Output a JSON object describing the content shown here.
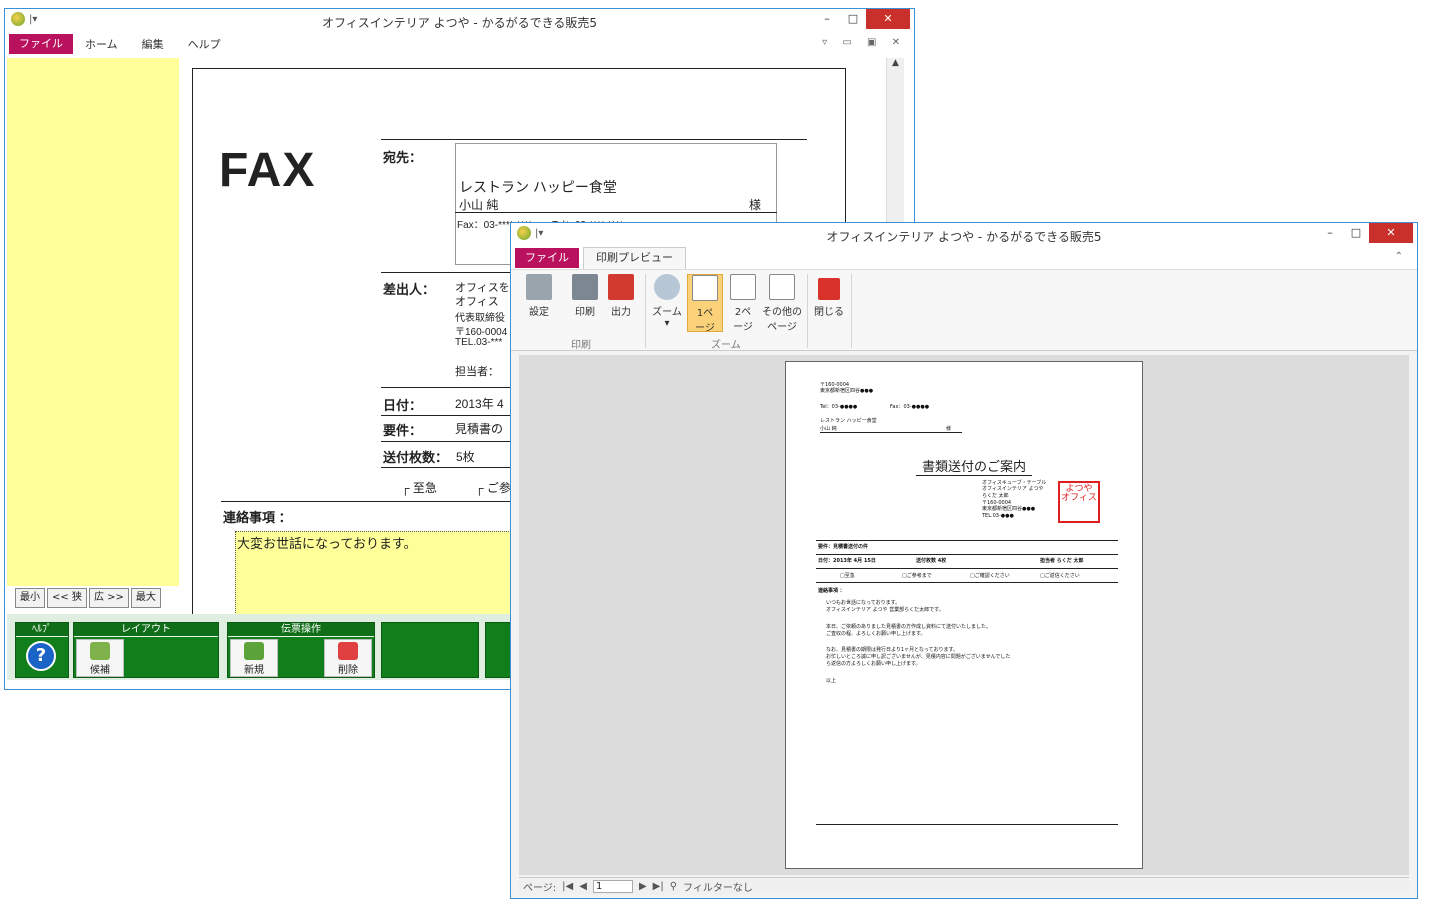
{
  "back": {
    "title": "オフィスインテリア よつや - かるがるできる販売5",
    "menu": [
      "ファイル",
      "ホーム",
      "編集",
      "ヘルプ"
    ],
    "zoom_buttons": [
      "最小",
      "<< 狭",
      "広 >>",
      "最大"
    ],
    "fax": {
      "heading": "FAX",
      "to_label": "宛先：",
      "to_company": "レストラン ハッピー食堂",
      "to_person": "小山 純",
      "to_suffix": "様",
      "to_contact": "Fax：03-**** ****　　Tel：03-**** ****",
      "from_label": "差出人：",
      "from_lines": [
        "オフィスを",
        "オフィス",
        "代表取締役",
        "〒160-0004",
        "TEL.03-***"
      ],
      "staff_label": "担当者：",
      "date_label": "日付：",
      "date_value": "2013年 4",
      "subject_label": "要件：",
      "subject_value": "見積書の",
      "pages_label": "送付枚数：",
      "pages_value": "5枚",
      "check1": "至急",
      "check2": "ご参",
      "notes_label": "連絡事項 ：",
      "notes_text": "大変お世話になっております。"
    },
    "bottom_groups": [
      {
        "label": "ﾍﾙﾌﾟ"
      },
      {
        "label": "レイアウト",
        "button": "候補"
      },
      {
        "label": "伝票操作",
        "buttons": [
          "新規",
          "削除"
        ]
      }
    ]
  },
  "front": {
    "title": "オフィスインテリア よつや - かるがるできる販売5",
    "tabs": [
      "ファイル",
      "印刷プレビュー"
    ],
    "buttons": {
      "setup": "設定",
      "print": "印刷",
      "output": "出力",
      "zoom": "ズーム",
      "one_page": "1ペ\nージ",
      "two_page": "2ペ\nージ",
      "other_pages": "その他の\nページ",
      "close": "閉じる"
    },
    "groups": {
      "print": "印刷",
      "zoom": "ズーム"
    },
    "page": {
      "header_lines": [
        "〒160-0004",
        "東京都新宿区四谷●●●",
        "Tel：03-●●●●",
        "Fax：03-●●●●"
      ],
      "to_company": "レストラン ハッピー食堂",
      "to_person": "小山 純",
      "to_suffix": "様",
      "doc_title": "書類送付のご案内",
      "stamp_text": "よつや\nオフィス",
      "sender_lines": [
        "オフィスキューブ・テーブル",
        "オフィスインテリア よつや",
        "らくだ 太郎",
        "〒160-0004",
        "東京都新宿区四谷●●●",
        "TEL.03-●●●"
      ],
      "subject": "要件：見積書送付の件",
      "date": "日付：2013年 4月 15日",
      "pages": "送付枚数 4枚",
      "staff": "担当者 らくだ 太郎",
      "checks": [
        "□至急",
        "□ご参考まで",
        "□ご確認ください",
        "□ご返信ください"
      ],
      "notes_label": "連絡事項 ：",
      "body": [
        "いつもお世話になっております。",
        "オフィスインテリア よつや 営業部らくだ太郎です。",
        "",
        "本日、ご依頼のありました見積書の方作成し資料にて送付いたしました。",
        "ご査収の程、よろしくお願い申し上げます。",
        "",
        "なお、見積書の期限は発行日より1ヶ月となっております。",
        "お忙しいところ誠に申し訳ございませんが、見積内容に問題がございませんでした",
        "ら返信の方よろしくお願い申し上げます。",
        "",
        "以上"
      ]
    },
    "status": {
      "page_label": "ページ:",
      "page_value": "1",
      "filter": "フィルターなし"
    }
  }
}
